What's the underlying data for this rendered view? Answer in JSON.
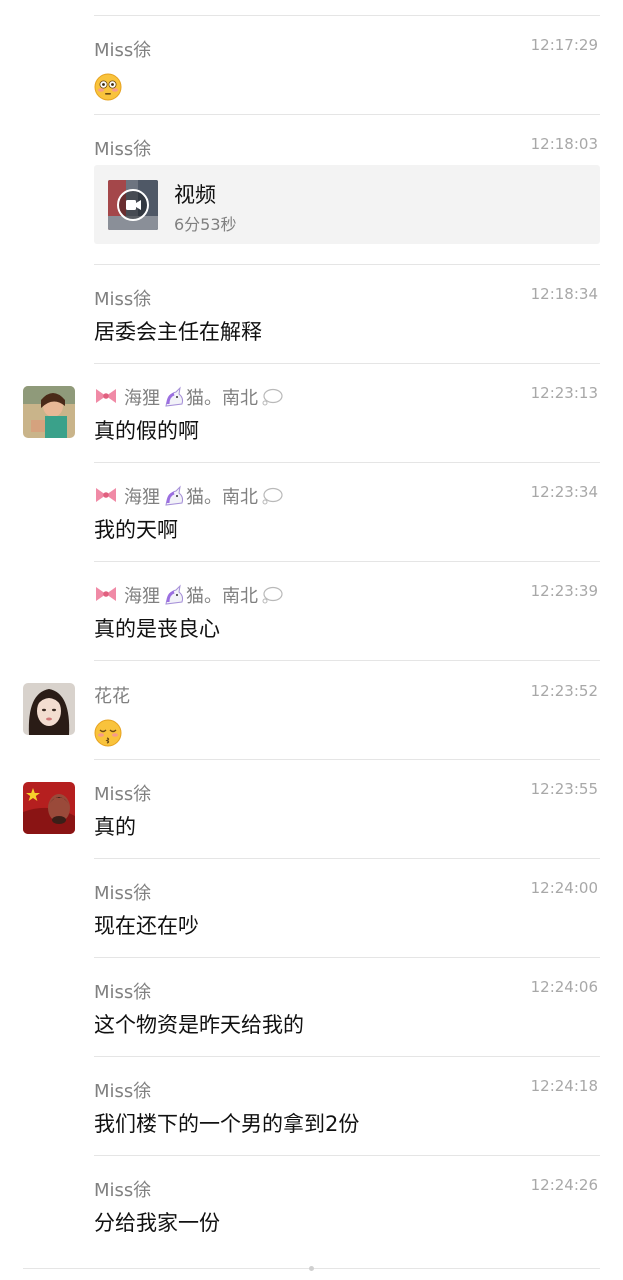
{
  "messages": [
    {
      "sender": "Miss徐",
      "time": "12:17:29",
      "emoji": "flushed-face"
    },
    {
      "sender": "Miss徐",
      "time": "12:18:03",
      "video": {
        "title": "视频",
        "duration": "6分53秒"
      }
    },
    {
      "sender": "Miss徐",
      "time": "12:18:34",
      "text": "居委会主任在解释"
    },
    {
      "sender": "海狸",
      "sender_mid": "猫。南北",
      "time": "12:23:13",
      "text": "真的假的啊"
    },
    {
      "sender": "海狸",
      "sender_mid": "猫。南北",
      "time": "12:23:34",
      "text": "我的天啊"
    },
    {
      "sender": "海狸",
      "sender_mid": "猫。南北",
      "time": "12:23:39",
      "text": "真的是丧良心"
    },
    {
      "sender": "花花",
      "time": "12:23:52",
      "emoji": "kissing-closed-eyes-face"
    },
    {
      "sender": "Miss徐",
      "time": "12:23:55",
      "text": "真的"
    },
    {
      "sender": "Miss徐",
      "time": "12:24:00",
      "text": "现在还在吵"
    },
    {
      "sender": "Miss徐",
      "time": "12:24:06",
      "text": "这个物资是昨天给我的"
    },
    {
      "sender": "Miss徐",
      "time": "12:24:18",
      "text": "我们楼下的一个男的拿到2份"
    },
    {
      "sender": "Miss徐",
      "time": "12:24:26",
      "text": "分给我家一份"
    }
  ]
}
